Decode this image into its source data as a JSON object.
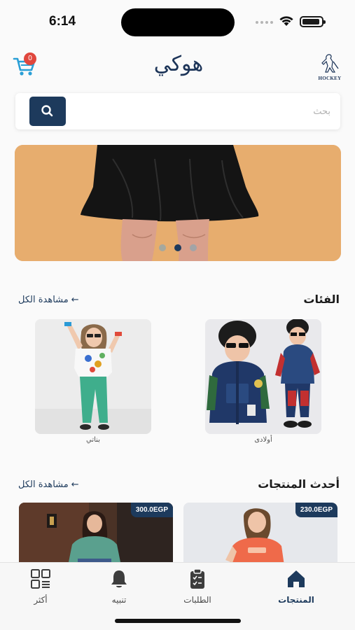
{
  "status_bar": {
    "time": "6:14"
  },
  "header": {
    "brand": "هوكي",
    "logo_text": "HOCKEY",
    "cart_count": "0"
  },
  "search": {
    "placeholder": "بحث"
  },
  "banner": {
    "slides": 3,
    "active_slide": 2
  },
  "categories": {
    "title": "الفئات",
    "view_all": "مشاهدة الكل",
    "items": [
      {
        "label": "أولادى"
      },
      {
        "label": "بناتي"
      }
    ]
  },
  "latest": {
    "title": "أحدث المنتجات",
    "view_all": "مشاهدة الكل",
    "items": [
      {
        "price": "230.0EGP"
      },
      {
        "price": "300.0EGP"
      }
    ]
  },
  "tabs": [
    {
      "label": "المنتجات",
      "icon": "home-icon",
      "active": true
    },
    {
      "label": "الطلبات",
      "icon": "clipboard-icon",
      "active": false
    },
    {
      "label": "تنبيه",
      "icon": "bell-icon",
      "active": false
    },
    {
      "label": "أكثر",
      "icon": "grid-icon",
      "active": false
    }
  ],
  "colors": {
    "primary": "#1d3a5c",
    "badge": "#e0473d",
    "banner_bg": "#e7ad6e"
  }
}
